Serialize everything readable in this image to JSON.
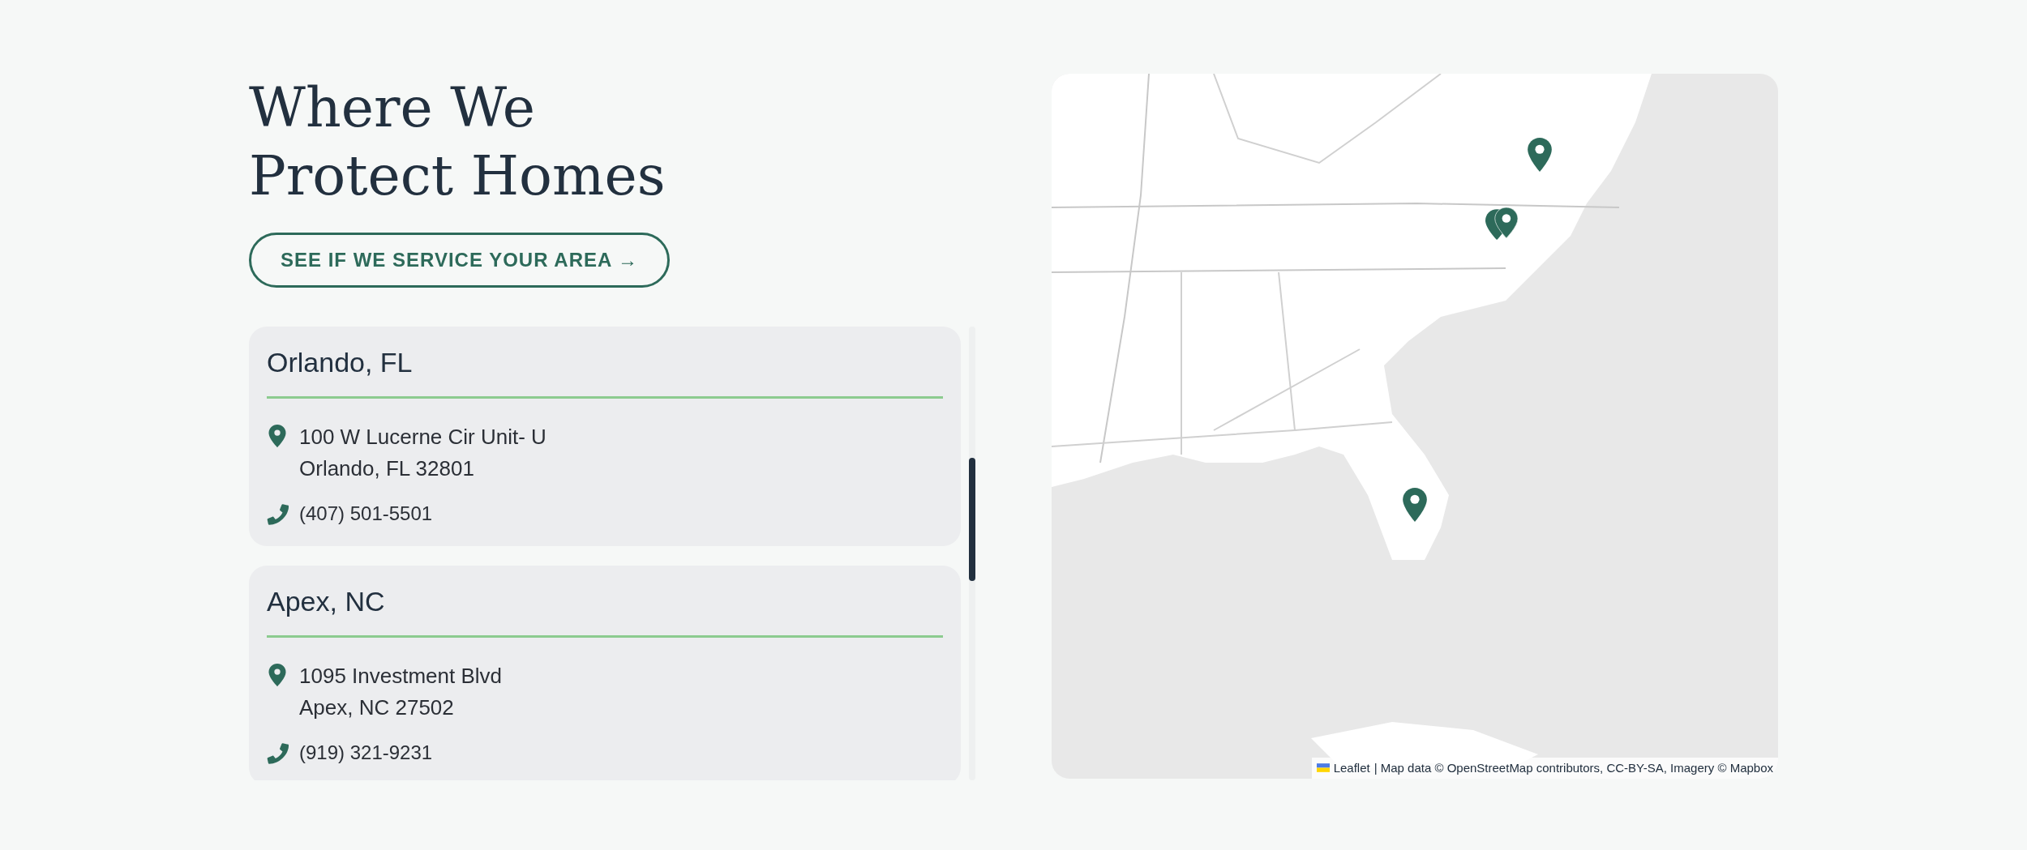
{
  "heading": {
    "lines": [
      "Where We",
      "Protect Homes"
    ]
  },
  "cta_button": {
    "label": "SEE IF WE SERVICE YOUR AREA →"
  },
  "locations": [
    {
      "city": "Orlando, FL",
      "address_lines": [
        "100 W Lucerne Cir Unit- U",
        "Orlando, FL 32801"
      ],
      "phone": "(407) 501-5501"
    },
    {
      "city": "Apex, NC",
      "address_lines": [
        "1095 Investment Blvd",
        "Apex, NC 27502"
      ],
      "phone": "(919) 321-9231"
    }
  ],
  "map": {
    "kind": "picture",
    "attribution": {
      "link": "Leaflet",
      "text": "| Map data © OpenStreetMap contributors, CC-BY-SA, Imagery © Mapbox"
    }
  }
}
